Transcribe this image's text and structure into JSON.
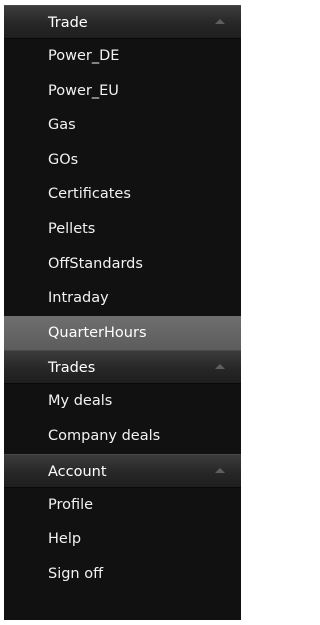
{
  "sections": {
    "trade": {
      "title": "Trade",
      "items": [
        "Power_DE",
        "Power_EU",
        "Gas",
        "GOs",
        "Certificates",
        "Pellets",
        "OffStandards",
        "Intraday",
        "QuarterHours"
      ],
      "active": "QuarterHours"
    },
    "trades": {
      "title": "Trades",
      "items": [
        "My deals",
        "Company deals"
      ]
    },
    "account": {
      "title": "Account",
      "items": [
        "Profile",
        "Help",
        "Sign off"
      ]
    }
  },
  "icons": {
    "collapse": "chevron-up-icon"
  },
  "colors": {
    "panel": "#111111",
    "active_item": "#666666",
    "text": "#f2f2f2"
  }
}
